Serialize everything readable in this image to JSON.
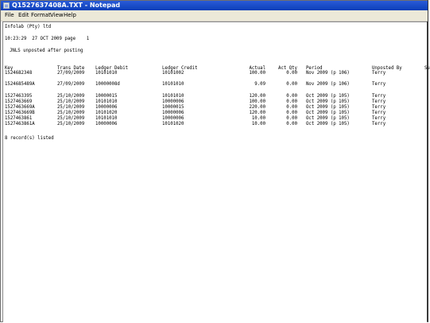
{
  "window": {
    "title": "Q1527637408A.TXT - Notepad"
  },
  "menu": [
    "File",
    "Edit",
    "Format",
    "View",
    "Help"
  ],
  "report": {
    "company": "Infolab (Pty) ltd",
    "header_line": "10:23:29  27 OCT 2009 page    1",
    "subtitle": "JNLS unposted after posting",
    "columns": [
      "Key",
      "Trans Date",
      "Ledger Debit",
      "Ledger Credit",
      "Actual",
      "Act Qty",
      "Period",
      "Unposted By",
      "Su"
    ],
    "rows": [
      [
        "1524682348",
        "27/09/2009",
        "10101010",
        "10101002",
        "100.00",
        "0.00",
        "Nov 2009 (p 106)",
        "Terry"
      ],
      [
        "1524685489A",
        "27/09/2009",
        "10000008d",
        "10101010",
        "9.09",
        "0.00",
        "Nov 2009 (p 106)",
        "Terry"
      ],
      [
        "1527463395",
        "25/10/2009",
        "10000015",
        "10101010",
        "120.00",
        "0.00",
        "Oct 2009 (p 105)",
        "Terry"
      ],
      [
        "1527463669",
        "25/10/2009",
        "10101010",
        "10000006",
        "100.00",
        "0.00",
        "Oct 2009 (p 105)",
        "Terry"
      ],
      [
        "1527463669A",
        "25/10/2009",
        "10000006",
        "10000015",
        "220.00",
        "0.00",
        "Oct 2009 (p 105)",
        "Terry"
      ],
      [
        "1527463669B",
        "25/10/2009",
        "10101020",
        "10000006",
        "120.00",
        "0.00",
        "Oct 2009 (p 105)",
        "Terry"
      ],
      [
        "1527463861",
        "25/10/2009",
        "10101010",
        "10000006",
        "10.00",
        "0.00",
        "Oct 2009 (p 105)",
        "Terry"
      ],
      [
        "1527463861A",
        "25/10/2009",
        "10000006",
        "10101020",
        "10.00",
        "0.00",
        "Oct 2009 (p 105)",
        "Terry"
      ]
    ],
    "footer": "8 record(s) listed"
  }
}
